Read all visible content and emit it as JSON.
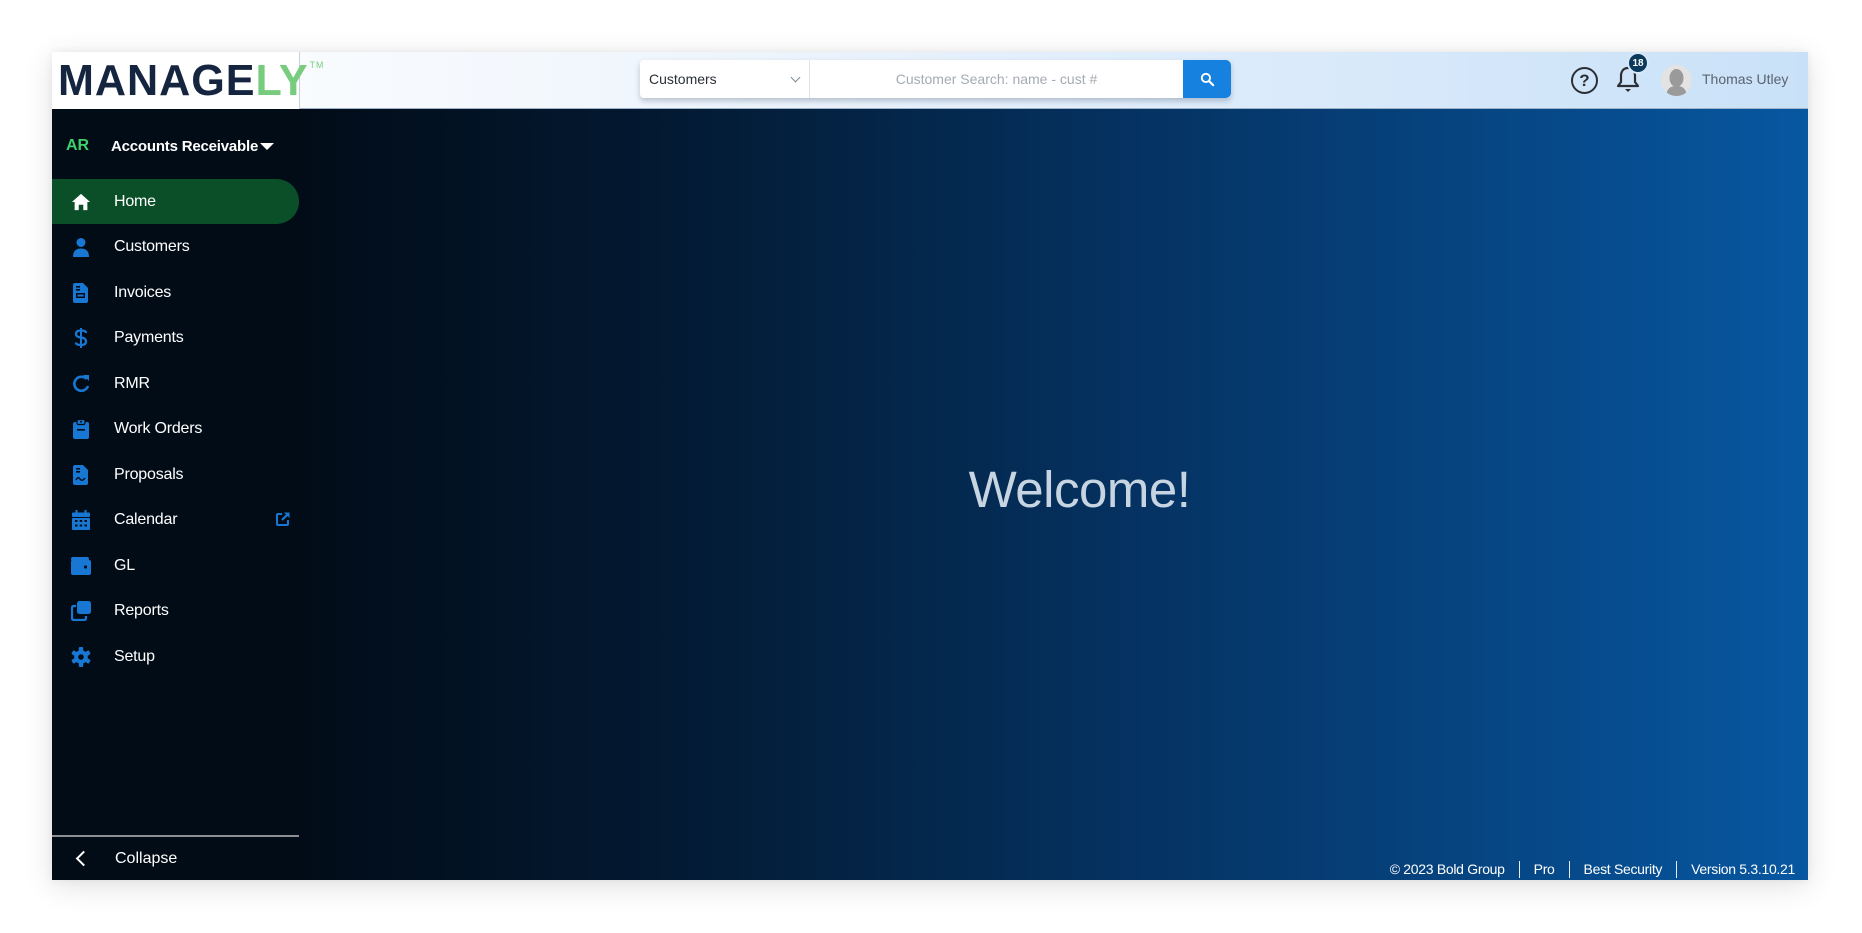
{
  "app": {
    "logo": {
      "main": "MANAGE",
      "accent": "LY",
      "trademark": "TM"
    },
    "colors": {
      "brand_navy": "#15253f",
      "brand_green": "#77cc7d",
      "active_nav": "#0b4f29",
      "accent_blue": "#1781e0",
      "icon_blue": "#1877d2",
      "module_green": "#3fcf6c"
    }
  },
  "header": {
    "search": {
      "scope_selected": "Customers",
      "placeholder": "Customer Search: name - cust #",
      "value": "",
      "button_icon": "search-icon"
    },
    "help_icon": "question-circle-icon",
    "notifications": {
      "icon": "bell-icon",
      "count": "18"
    },
    "user": {
      "name": "Thomas Utley",
      "avatar_icon": "user-silhouette-icon"
    }
  },
  "sidebar": {
    "module": {
      "abbr": "AR",
      "name": "Accounts Receivable",
      "icon": "caret-down-icon"
    },
    "items": [
      {
        "label": "Home",
        "icon": "home-icon",
        "active": true
      },
      {
        "label": "Customers",
        "icon": "user-icon",
        "active": false
      },
      {
        "label": "Invoices",
        "icon": "invoice-icon",
        "active": false
      },
      {
        "label": "Payments",
        "icon": "dollar-icon",
        "active": false
      },
      {
        "label": "RMR",
        "icon": "refresh-icon",
        "active": false
      },
      {
        "label": "Work Orders",
        "icon": "clipboard-icon",
        "active": false
      },
      {
        "label": "Proposals",
        "icon": "proposal-icon",
        "active": false
      },
      {
        "label": "Calendar",
        "icon": "calendar-icon",
        "active": false,
        "external": true
      },
      {
        "label": "GL",
        "icon": "wallet-icon",
        "active": false
      },
      {
        "label": "Reports",
        "icon": "reports-icon",
        "active": false
      },
      {
        "label": "Setup",
        "icon": "gear-icon",
        "active": false
      }
    ],
    "collapse_label": "Collapse"
  },
  "main": {
    "welcome": "Welcome!"
  },
  "footer": {
    "copyright": "© 2023 Bold Group",
    "plan": "Pro",
    "company": "Best Security",
    "version": "Version 5.3.10.21"
  }
}
